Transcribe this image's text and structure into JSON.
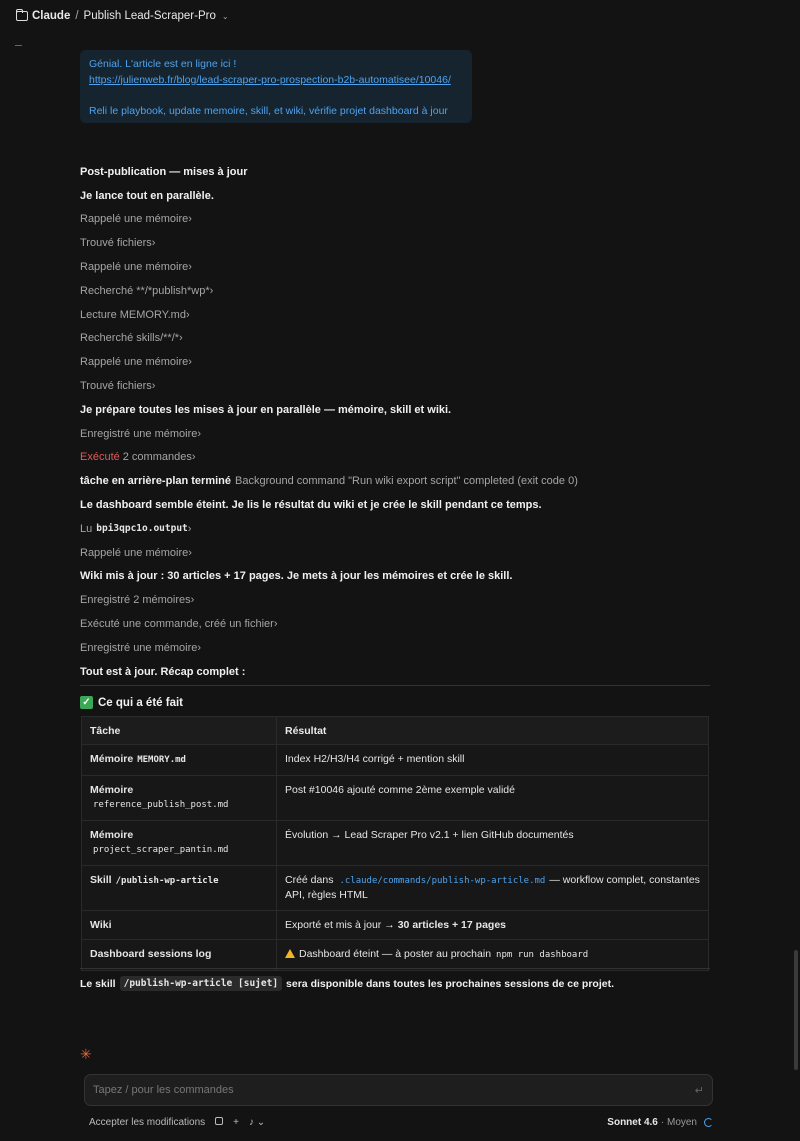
{
  "header": {
    "workspace": "Claude",
    "separator": "/",
    "project": "Publish Lead-Scraper-Pro",
    "chevron": "⌄"
  },
  "user_message": {
    "line1": "Génial. L'article est en ligne ici !",
    "link": "https://julienweb.fr/blog/lead-scraper-pro-prospection-b2b-automatisee/10046/",
    "line3": "Reli le playbook, update memoire, skill, et wiki, vérifie projet dashboard à jour"
  },
  "transcript": [
    {
      "kind": "bold",
      "text": "Post-publication — mises à jour"
    },
    {
      "kind": "plain",
      "text": "Je lance tout en parallèle."
    },
    {
      "kind": "tool",
      "text": "Rappelé une mémoire"
    },
    {
      "kind": "tool",
      "text": "Trouvé fichiers"
    },
    {
      "kind": "tool",
      "text": "Rappelé une mémoire"
    },
    {
      "kind": "tool",
      "text": "Recherché **/*publish*wp*"
    },
    {
      "kind": "tool",
      "text": "Lecture MEMORY.md"
    },
    {
      "kind": "tool",
      "text": "Recherché skills/**/*"
    },
    {
      "kind": "tool",
      "text": "Rappelé une mémoire"
    },
    {
      "kind": "tool",
      "text": "Trouvé fichiers"
    },
    {
      "kind": "plain",
      "text": "Je prépare toutes les mises à jour en parallèle — mémoire, skill et wiki."
    },
    {
      "kind": "tool",
      "text": "Enregistré une mémoire"
    },
    {
      "kind": "exec",
      "red": "Exécuté",
      "text": "2 commandes"
    },
    {
      "kind": "bg",
      "label": "tâche en arrière-plan terminé",
      "text": "Background command \"Run wiki export script\" completed (exit code 0)"
    },
    {
      "kind": "plain",
      "text": "Le dashboard semble éteint. Je lis le résultat du wiki et je crée le skill pendant ce temps."
    },
    {
      "kind": "read",
      "prefix": "Lu",
      "code": "bpi3qpc1o.output"
    },
    {
      "kind": "tool",
      "text": "Rappelé une mémoire"
    },
    {
      "kind": "plain",
      "text": "Wiki mis à jour : 30 articles + 17 pages. Je mets à jour les mémoires et crée le skill."
    },
    {
      "kind": "tool",
      "text": "Enregistré 2 mémoires"
    },
    {
      "kind": "tool",
      "text": "Exécuté une commande, créé un fichier"
    },
    {
      "kind": "tool",
      "text": "Enregistré une mémoire"
    },
    {
      "kind": "plain",
      "text": "Tout est à jour. Récap complet :"
    }
  ],
  "recap": {
    "title": "Ce qui a été fait",
    "headers": [
      "Tâche",
      "Résultat"
    ],
    "rows": [
      {
        "task": "Mémoire",
        "task_code": "MEMORY.md",
        "inline": true,
        "result": "Index H2/H3/H4 corrigé + mention skill"
      },
      {
        "task": "Mémoire",
        "task_code": "reference_publish_post.md",
        "inline": false,
        "result": "Post #10046 ajouté comme 2ème exemple validé"
      },
      {
        "task": "Mémoire",
        "task_code": "project_scraper_pantin.md",
        "inline": false,
        "result": "Évolution → Lead Scraper Pro v2.1 + lien GitHub documentés"
      },
      {
        "task": "Skill",
        "task_code": "/publish-wp-article",
        "inline": true,
        "result_pre": "Créé dans",
        "result_code": ".claude/commands/publish-wp-article.md",
        "result": "— workflow complet, constantes API, règles HTML"
      },
      {
        "task": "Wiki",
        "task_code": "",
        "inline": true,
        "result_pre": "Exporté et mis à jour →",
        "result_bold": "30 articles + 17 pages"
      },
      {
        "task": "Dashboard sessions log",
        "task_code": "",
        "inline": true,
        "result": "Dashboard éteint — à poster au prochain",
        "result_code_end": "npm run dashboard",
        "warn": true
      }
    ]
  },
  "footer_note": {
    "pre": "Le skill",
    "code": "/publish-wp-article [sujet]",
    "post": "sera disponible dans toutes les prochaines sessions de ce projet."
  },
  "composer": {
    "placeholder": "Tapez / pour les commandes",
    "accept_label": "Accepter les modifications",
    "model": "Sonnet 4.6",
    "effort": "· Moyen"
  },
  "colors": {
    "accent": "#4da3f0",
    "executed_red": "#e05a5a",
    "check_green": "#3aa856",
    "warn_yellow": "#f0b429"
  }
}
